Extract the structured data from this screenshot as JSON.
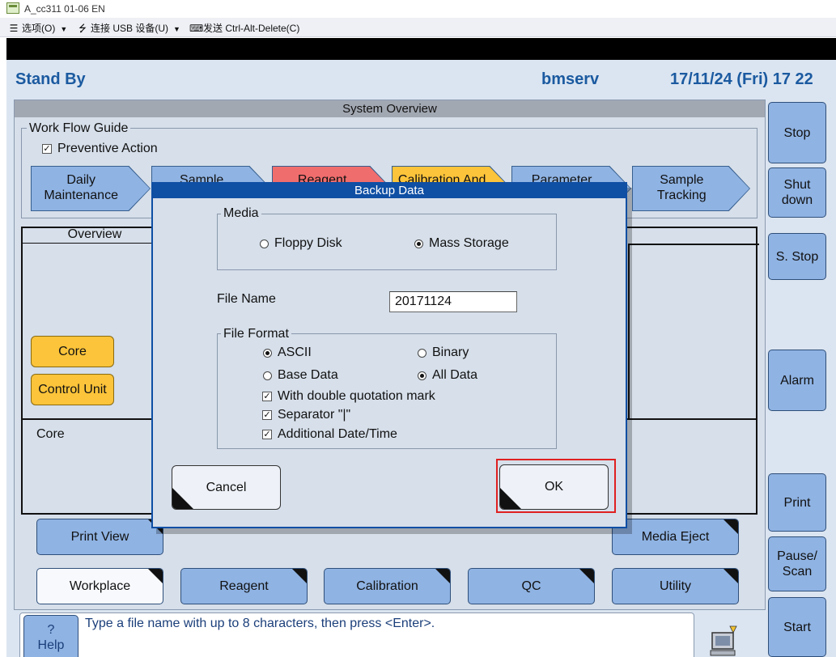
{
  "window": {
    "title": "A_cc311 01-06 EN",
    "menu": [
      {
        "icon": "hamburger-icon",
        "label": "选项(O)"
      },
      {
        "icon": "usb-icon",
        "label": "连接 USB 设备(U)"
      },
      {
        "icon": "keyboard-icon",
        "label": "发送 Ctrl-Alt-Delete(C)"
      }
    ]
  },
  "header": {
    "status": "Stand By",
    "user": "bmserv",
    "datetime": "17/11/24 (Fri) 17 22"
  },
  "panel": {
    "title": "System Overview",
    "workflow_guide_label": "Work Flow Guide",
    "preventive_action_label": "Preventive Action",
    "preventive_action_checked": true,
    "flow_steps": [
      {
        "label": "Daily\nMaintenance",
        "color": "#8fb3e3"
      },
      {
        "label": "Sample",
        "color": "#8fb3e3"
      },
      {
        "label": "Reagent",
        "color": "#f06d6d"
      },
      {
        "label": "Calibration And",
        "color": "#fcc43a"
      },
      {
        "label": "Parameter",
        "color": "#8fb3e3"
      },
      {
        "label": "Sample\nTracking",
        "color": "#8fb3e3"
      }
    ],
    "overview_tab": "Overview",
    "core_button": "Core",
    "control_unit_button": "Control Unit",
    "core_section_label": "Core",
    "print_view_button": "Print View",
    "media_eject_button": "Media Eject"
  },
  "bottom_tabs": [
    {
      "label": "Workplace",
      "active": true
    },
    {
      "label": "Reagent",
      "active": false
    },
    {
      "label": "Calibration",
      "active": false
    },
    {
      "label": "QC",
      "active": false
    },
    {
      "label": "Utility",
      "active": false
    }
  ],
  "side_buttons": {
    "stop": "Stop",
    "shutdown": "Shut\ndown",
    "s_stop": "S. Stop",
    "alarm": "Alarm",
    "print": "Print",
    "pause_scan": "Pause/\nScan",
    "start": "Start"
  },
  "help": {
    "symbol": "?",
    "label": "Help"
  },
  "message": "Type a file name with up to 8 characters, then press <Enter>.",
  "dialog": {
    "title": "Backup Data",
    "media_group": "Media",
    "media_options": [
      {
        "label": "Floppy Disk",
        "selected": false
      },
      {
        "label": "Mass Storage",
        "selected": true
      }
    ],
    "file_name_label": "File Name",
    "file_name_value": "20171124",
    "file_format_group": "File Format",
    "format_options": [
      {
        "label": "ASCII",
        "selected": true
      },
      {
        "label": "Binary",
        "selected": false
      }
    ],
    "data_options": [
      {
        "label": "Base Data",
        "selected": false
      },
      {
        "label": "All Data",
        "selected": true
      }
    ],
    "checkboxes": [
      {
        "label": "With double quotation mark",
        "checked": true
      },
      {
        "label": "Separator \"|\"",
        "checked": true
      },
      {
        "label": "Additional Date/Time",
        "checked": true
      }
    ],
    "cancel_button": "Cancel",
    "ok_button": "OK"
  }
}
